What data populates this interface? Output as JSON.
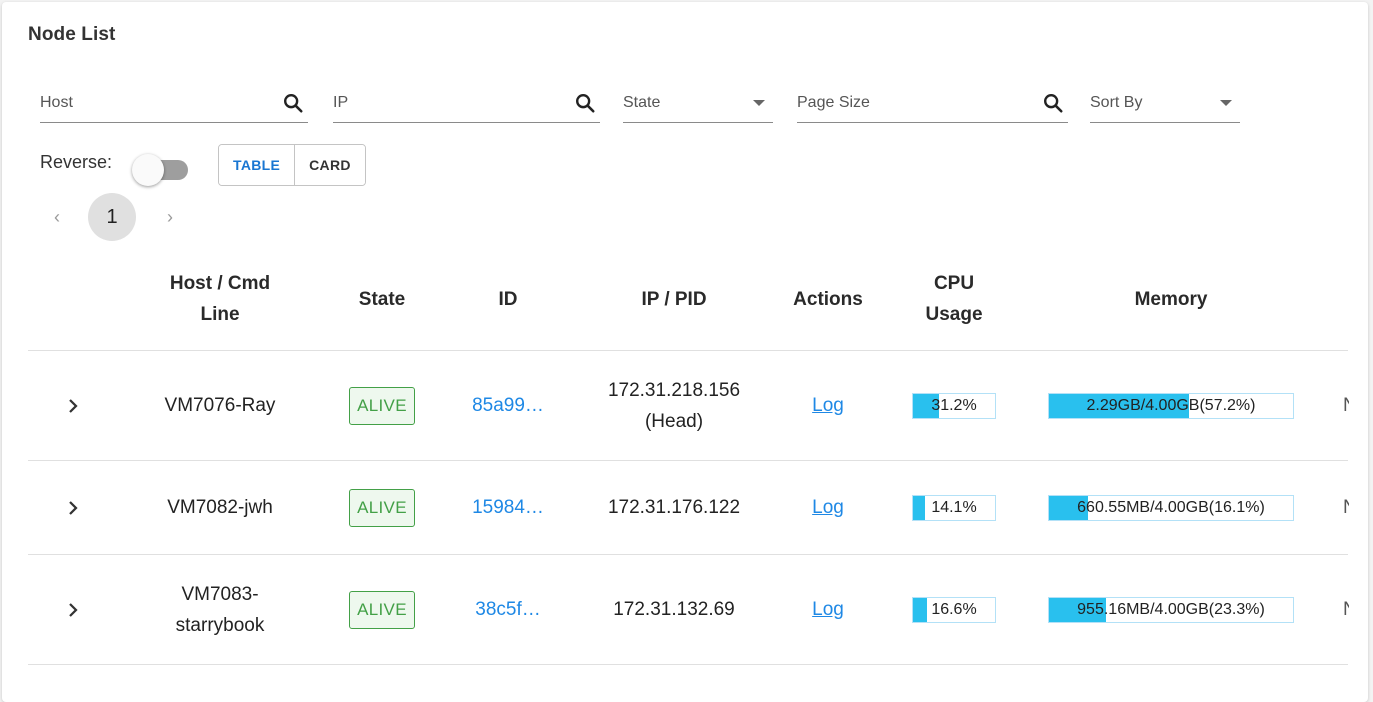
{
  "panel": {
    "title": "Node List"
  },
  "filters": {
    "host_label": "Host",
    "ip_label": "IP",
    "state_label": "State",
    "page_size_label": "Page Size",
    "sort_by_label": "Sort By"
  },
  "controls": {
    "reverse_label": "Reverse:",
    "reverse_on": false,
    "view_table": "TABLE",
    "view_card": "CARD",
    "selected_view": "TABLE"
  },
  "pagination": {
    "prev": "‹",
    "current_page": "1",
    "next": "›"
  },
  "table": {
    "headers": [
      "",
      "Host / Cmd Line",
      "State",
      "ID",
      "IP / PID",
      "Actions",
      "CPU Usage",
      "Memory"
    ],
    "rows": [
      {
        "host": "VM7076-Ray",
        "state": "ALIVE",
        "id": "85a99…",
        "ip": "172.31.218.156 (Head)",
        "action": "Log",
        "cpu_text": "31.2%",
        "cpu_fraction": 0.312,
        "memory_text": "2.29GB/4.00GB(57.2%)",
        "memory_fraction": 0.572,
        "more": "N"
      },
      {
        "host": "VM7082-jwh",
        "state": "ALIVE",
        "id": "15984…",
        "ip": "172.31.176.122",
        "action": "Log",
        "cpu_text": "14.1%",
        "cpu_fraction": 0.141,
        "memory_text": "660.55MB/4.00GB(16.1%)",
        "memory_fraction": 0.161,
        "more": "N"
      },
      {
        "host": "VM7083-starrybook",
        "state": "ALIVE",
        "id": "38c5f…",
        "ip": "172.31.132.69",
        "action": "Log",
        "cpu_text": "16.6%",
        "cpu_fraction": 0.166,
        "memory_text": "955.16MB/4.00GB(23.3%)",
        "memory_fraction": 0.233,
        "more": "N"
      }
    ]
  },
  "colors": {
    "accent": "#1976d2",
    "link": "#1e88e5",
    "alive": "#43a047",
    "bar_fill": "#29c0ee",
    "bar_border": "#b3e1f7"
  },
  "icons": {
    "search": "search-icon",
    "dropdown": "caret-down-icon",
    "expand": "chevron-right-icon"
  }
}
